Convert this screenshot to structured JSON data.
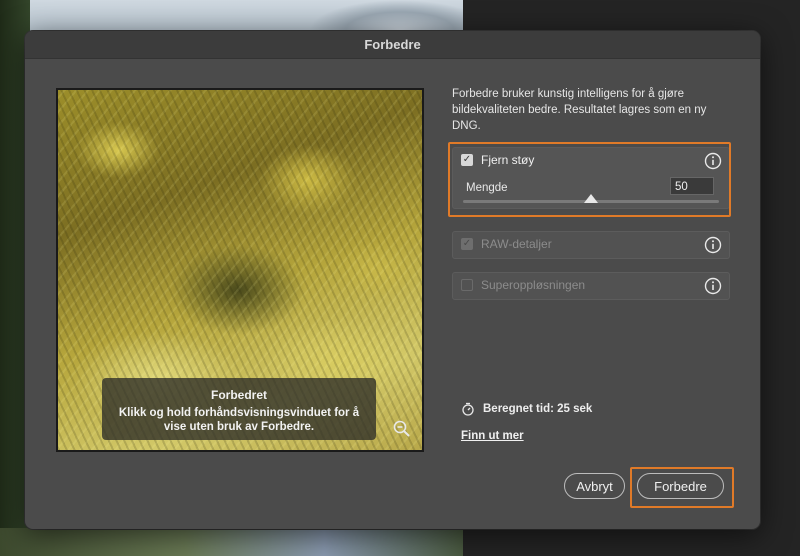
{
  "dialog": {
    "title": "Forbedre",
    "description": "Forbedre bruker kunstig intelligens for å gjøre bildekvaliteten bedre. Resultatet lagres som en ny DNG."
  },
  "preview": {
    "caption_title": "Forbedret",
    "caption_text": "Klikk og hold forhåndsvisningsvinduet for å vise uten bruk av Forbedre."
  },
  "options": {
    "denoise": {
      "label": "Fjern støy",
      "checked": true,
      "amount_label": "Mengde",
      "amount_value": "50",
      "amount_level": 0.5
    },
    "raw_details": {
      "label": "RAW-detaljer",
      "checked": true,
      "disabled": true
    },
    "super_resolution": {
      "label": "Superoppløsningen",
      "checked": false,
      "disabled": true
    }
  },
  "estimate": {
    "text": "Beregnet tid: 25 sek"
  },
  "learn_more": "Finn ut mer",
  "buttons": {
    "cancel": "Avbryt",
    "enhance": "Forbedre"
  },
  "colors": {
    "highlight": "#e07a28",
    "dialog_bg": "#4b4b4b"
  }
}
